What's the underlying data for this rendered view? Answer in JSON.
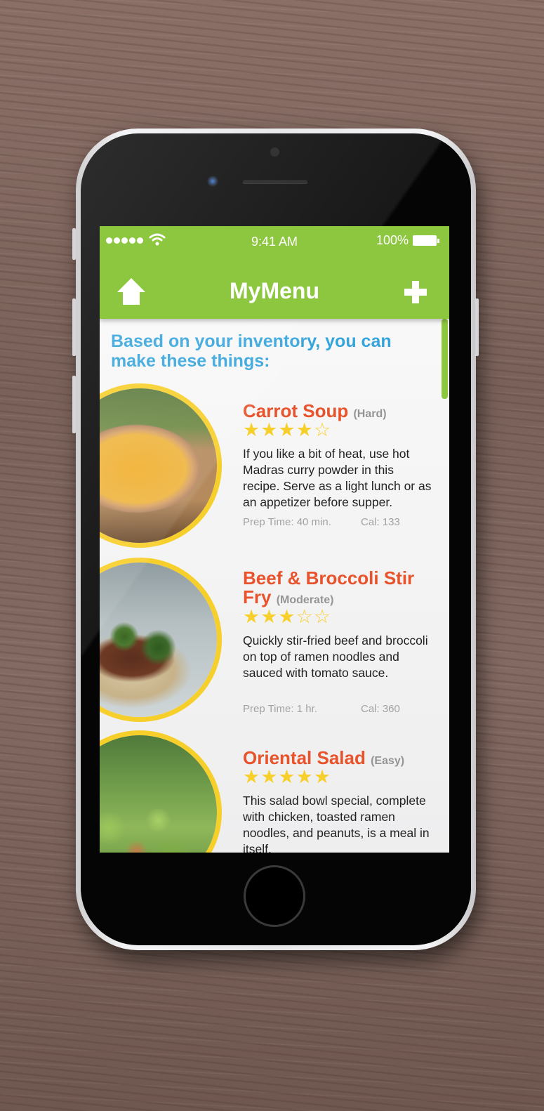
{
  "status_bar": {
    "time": "9:41 AM",
    "battery": "100%"
  },
  "header": {
    "title": "MyMenu",
    "home_icon": "home-icon",
    "add_icon": "plus-icon"
  },
  "intro": "Based on your inventory, you can make these things:",
  "colors": {
    "header_green": "#8dc63f",
    "intro_blue": "#36a5dc",
    "title_orange": "#e8532b",
    "star_yellow": "#f7cf2a"
  },
  "recipes": [
    {
      "name": "Carrot Soup",
      "difficulty": "(Hard)",
      "rating": 4,
      "stars": "★★★★☆",
      "description": "If you like a bit of heat, use hot Madras curry powder in this recipe. Serve as a light lunch or as an appetizer before supper.",
      "prep": "Prep Time: 40 min.",
      "cal": "Cal: 133"
    },
    {
      "name": "Beef & Broccoli Stir Fry",
      "difficulty": "(Moderate)",
      "rating": 3,
      "stars": "★★★☆☆",
      "description": "Quickly stir-fried beef and broccoli on top of ramen noodles and sauced with tomato sauce.",
      "prep": "Prep Time: 1 hr.",
      "cal": "Cal: 360"
    },
    {
      "name": "Oriental Salad",
      "difficulty": "(Easy)",
      "rating": 5,
      "stars": "★★★★★",
      "description": "This salad bowl special, complete with chicken, toasted ramen noodles, and peanuts, is a meal in itself."
    }
  ]
}
